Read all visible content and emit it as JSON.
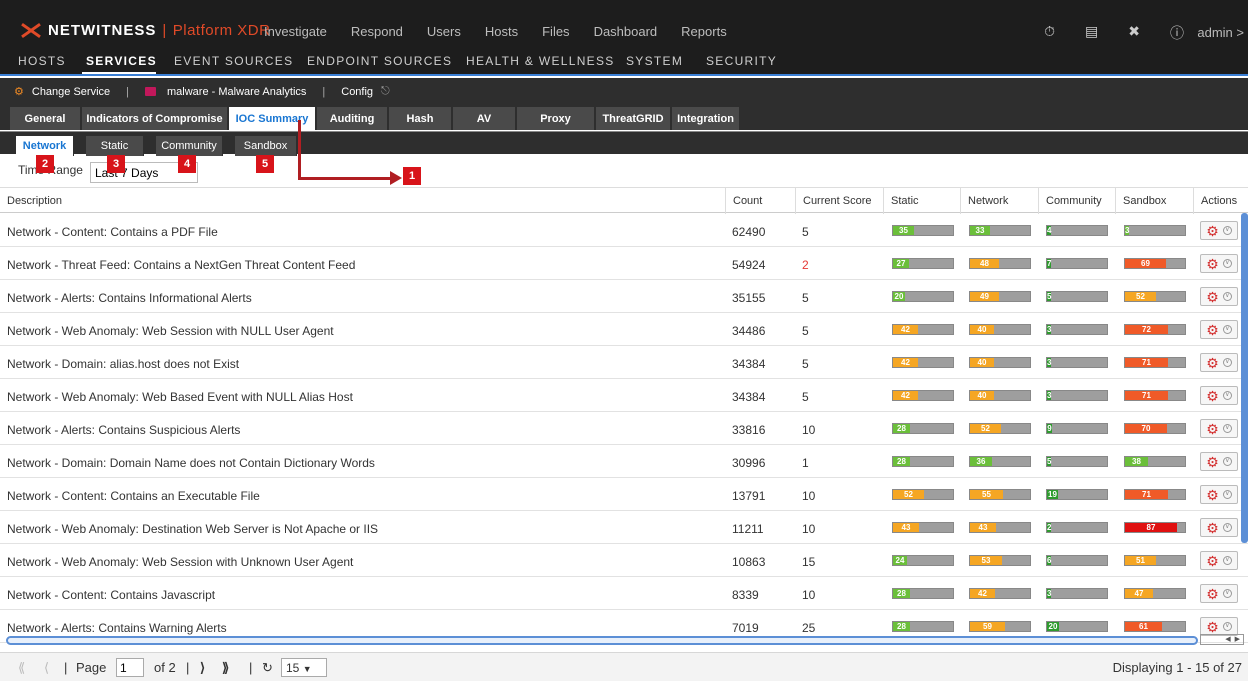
{
  "app": {
    "brand": "NETWITNESS",
    "product": "Platform XDR",
    "top_nav": [
      "Investigate",
      "Respond",
      "Users",
      "Hosts",
      "Files",
      "Dashboard",
      "Reports"
    ],
    "user_menu": "admin >"
  },
  "admin_nav": {
    "items": [
      "HOSTS",
      "SERVICES",
      "EVENT SOURCES",
      "ENDPOINT SOURCES",
      "HEALTH & WELLNESS",
      "SYSTEM",
      "SECURITY"
    ],
    "active": "SERVICES"
  },
  "service_bar": {
    "change_service": "Change Service",
    "service_name": "malware - Malware Analytics",
    "config": "Config"
  },
  "config_tabs": {
    "items": [
      "General",
      "Indicators of Compromise",
      "IOC Summary",
      "Auditing",
      "Hash",
      "AV",
      "Proxy",
      "ThreatGRID",
      "Integration"
    ],
    "active": "IOC Summary"
  },
  "summary_tabs": {
    "items": [
      "Network",
      "Static",
      "Community",
      "Sandbox"
    ],
    "active": "Network"
  },
  "time_range": {
    "label": "Time Range",
    "value": "Last 7 Days"
  },
  "callouts": [
    "1",
    "2",
    "3",
    "4",
    "5"
  ],
  "table": {
    "columns": [
      "Description",
      "Count",
      "Current Score",
      "Static",
      "Network",
      "Community",
      "Sandbox",
      "Actions"
    ],
    "rows": [
      {
        "description": "Network - Content: Contains a PDF File",
        "count": "62490",
        "score": "5",
        "static": 35,
        "network": 33,
        "community": 4,
        "sandbox": 3
      },
      {
        "description": "Network - Threat Feed: Contains a NextGen Threat Content Feed",
        "count": "54924",
        "score": "2",
        "static": 27,
        "network": 48,
        "community": 7,
        "sandbox": 69
      },
      {
        "description": "Network - Alerts: Contains Informational Alerts",
        "count": "35155",
        "score": "5",
        "static": 20,
        "network": 49,
        "community": 5,
        "sandbox": 52
      },
      {
        "description": "Network - Web Anomaly: Web Session with NULL User Agent",
        "count": "34486",
        "score": "5",
        "static": 42,
        "network": 40,
        "community": 3,
        "sandbox": 72
      },
      {
        "description": "Network - Domain: alias.host does not Exist",
        "count": "34384",
        "score": "5",
        "static": 42,
        "network": 40,
        "community": 3,
        "sandbox": 71
      },
      {
        "description": "Network - Web Anomaly: Web Based Event with NULL Alias Host",
        "count": "34384",
        "score": "5",
        "static": 42,
        "network": 40,
        "community": 3,
        "sandbox": 71
      },
      {
        "description": "Network - Alerts: Contains Suspicious Alerts",
        "count": "33816",
        "score": "10",
        "static": 28,
        "network": 52,
        "community": 9,
        "sandbox": 70
      },
      {
        "description": "Network - Domain: Domain Name does not Contain Dictionary Words",
        "count": "30996",
        "score": "1",
        "static": 28,
        "network": 36,
        "community": 5,
        "sandbox": 38
      },
      {
        "description": "Network - Content: Contains an Executable File",
        "count": "13791",
        "score": "10",
        "static": 52,
        "network": 55,
        "community": 19,
        "sandbox": 71
      },
      {
        "description": "Network - Web Anomaly: Destination Web Server is Not Apache or IIS",
        "count": "11211",
        "score": "10",
        "static": 43,
        "network": 43,
        "community": 2,
        "sandbox": 87
      },
      {
        "description": "Network - Web Anomaly: Web Session with Unknown User Agent",
        "count": "10863",
        "score": "15",
        "static": 24,
        "network": 53,
        "community": 6,
        "sandbox": 51
      },
      {
        "description": "Network - Content: Contains Javascript",
        "count": "8339",
        "score": "10",
        "static": 28,
        "network": 42,
        "community": 3,
        "sandbox": 47
      },
      {
        "description": "Network - Alerts: Contains Warning Alerts",
        "count": "7019",
        "score": "25",
        "static": 28,
        "network": 59,
        "community": 20,
        "sandbox": 61
      }
    ]
  },
  "pager": {
    "page_label": "Page",
    "page_value": "1",
    "of_label": "of 2",
    "page_size": "15",
    "display_text": "Displaying 1 - 15 of 27"
  },
  "colors": {
    "accent": "#1976d2",
    "green": "#6bbf3a",
    "dark_green": "#2e9b2e",
    "orange": "#f5a623",
    "red_orange": "#f05a28",
    "red": "#e01010",
    "callout": "#d8141a"
  }
}
